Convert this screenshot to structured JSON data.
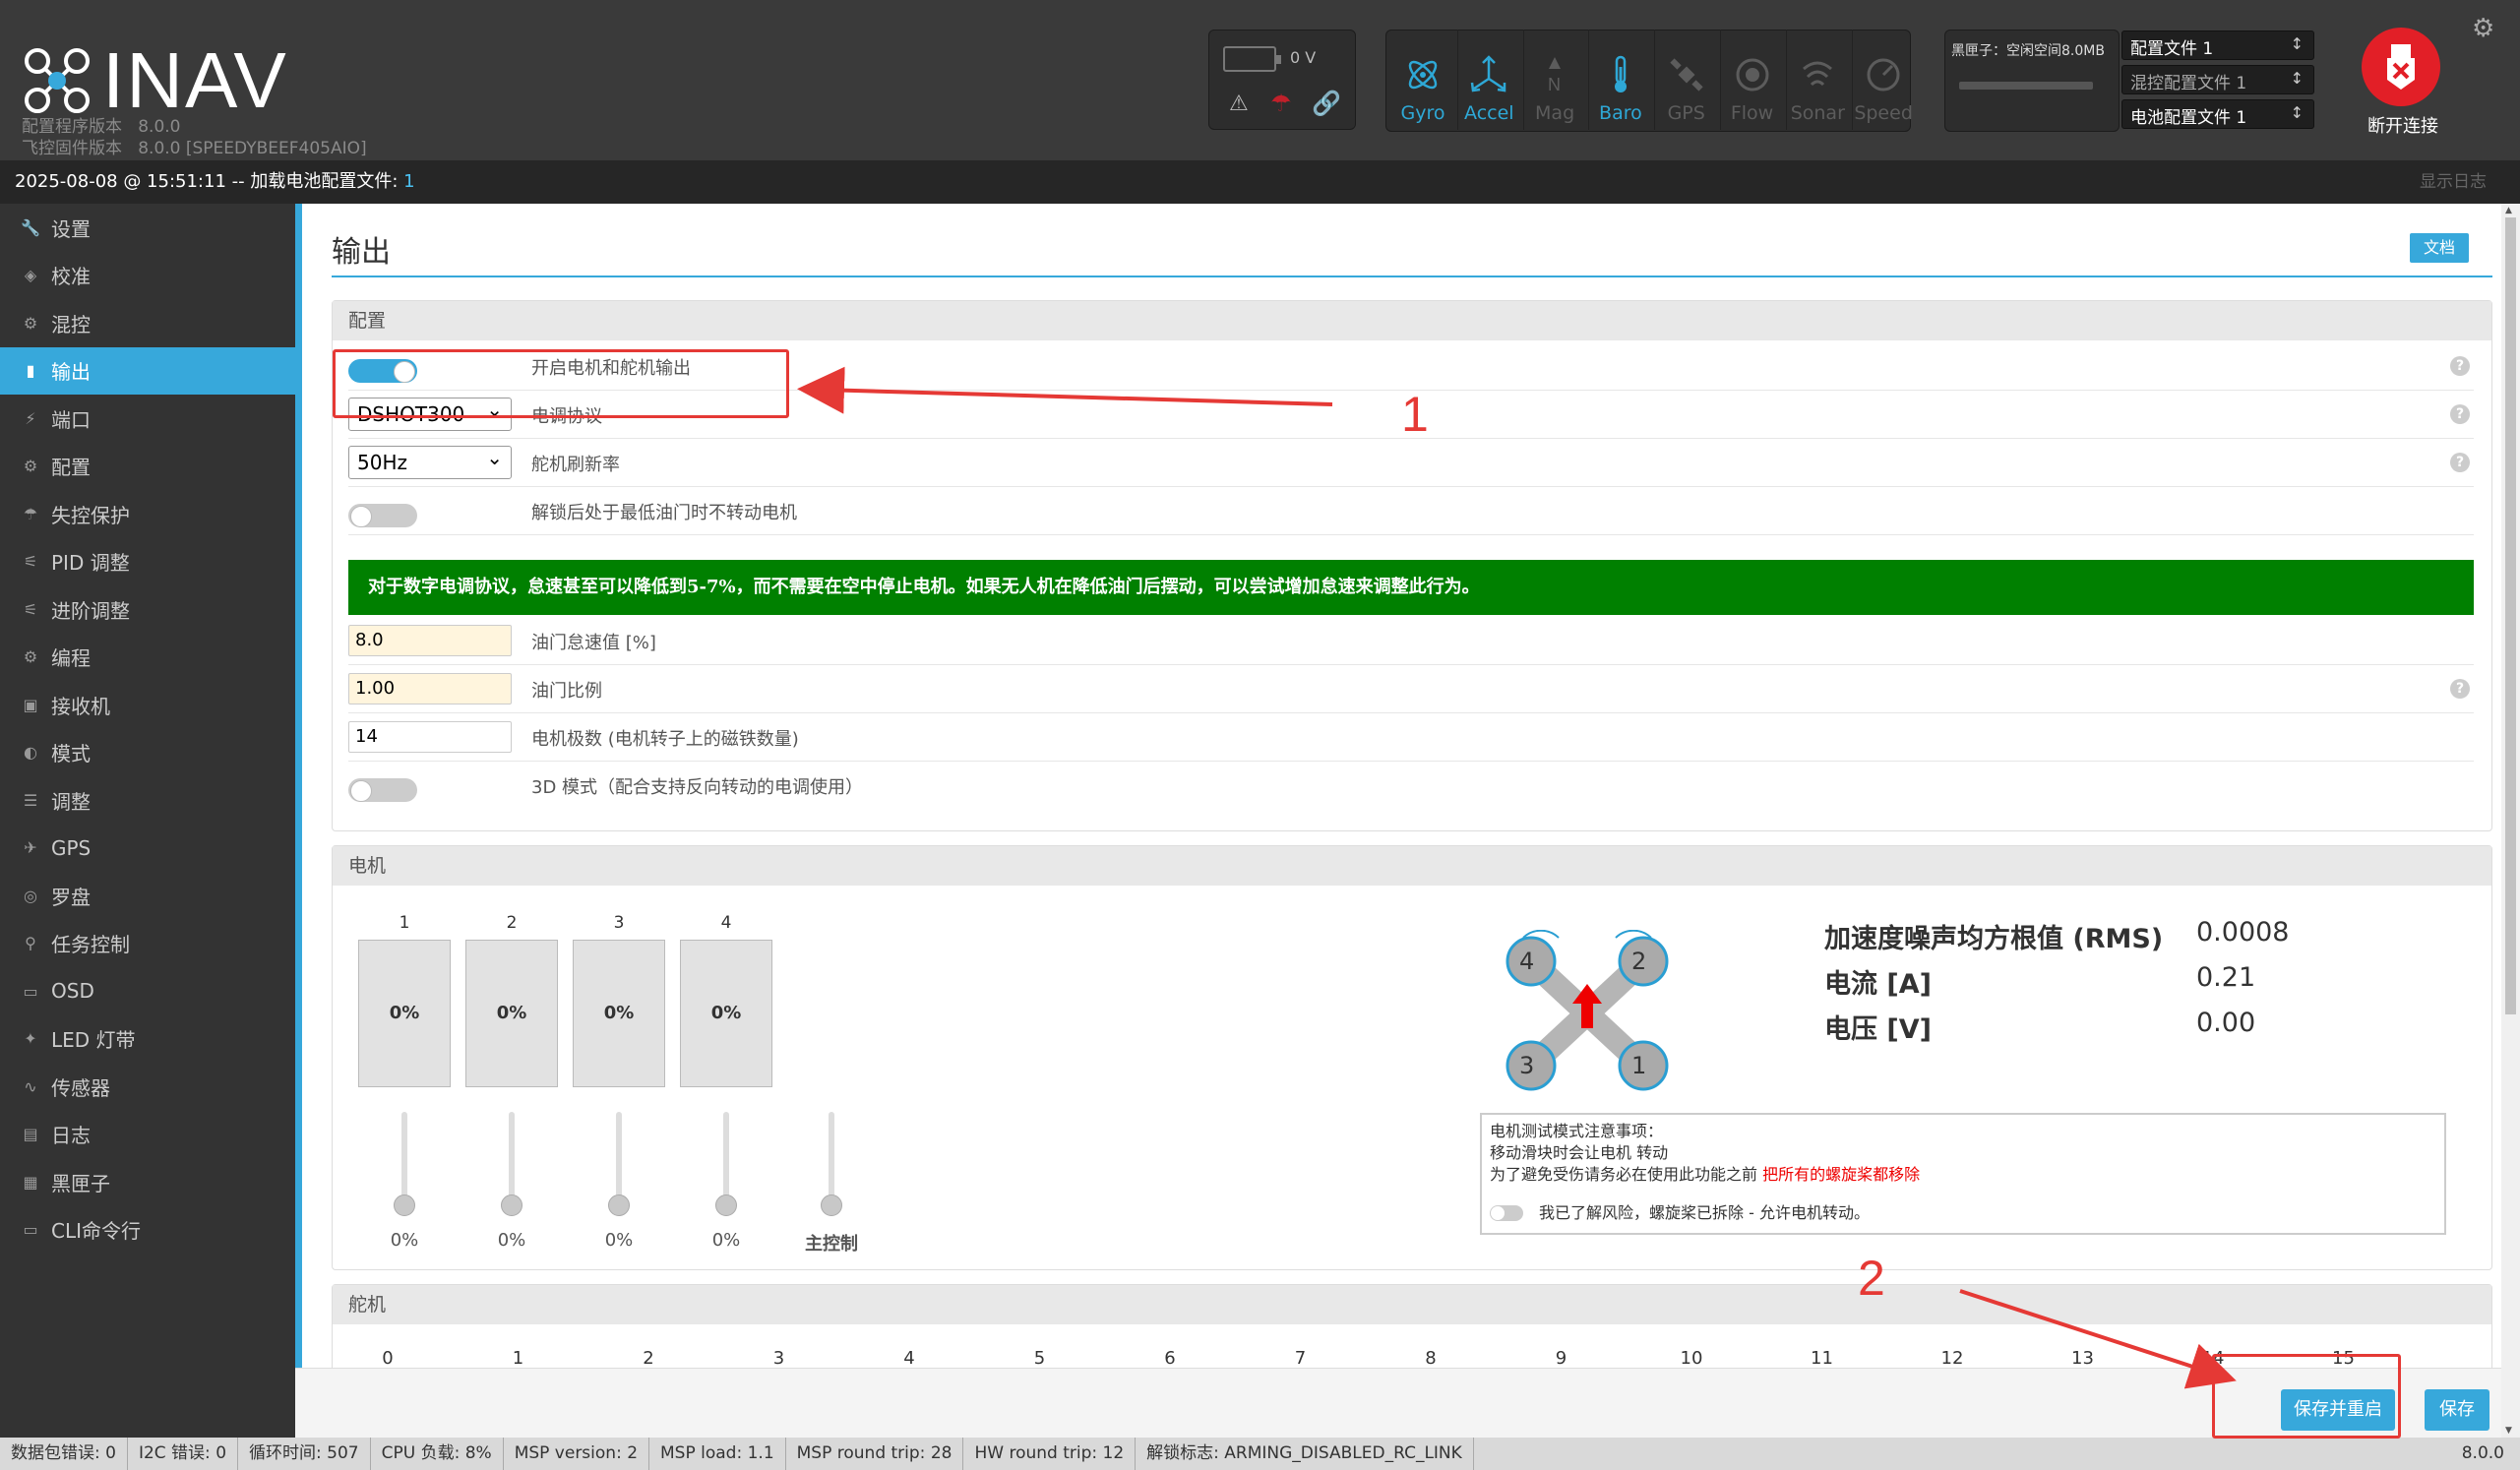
{
  "header": {
    "app_name": "INAV",
    "configurator_version_label": "配置程序版本",
    "configurator_version": "8.0.0",
    "firmware_version_label": "飞控固件版本",
    "firmware_version": "8.0.0 [SPEEDYBEEF405AIO]",
    "battery_voltage": "0 V",
    "sensors": [
      {
        "name": "Gyro",
        "active": true
      },
      {
        "name": "Accel",
        "active": true
      },
      {
        "name": "Mag",
        "active": false
      },
      {
        "name": "Baro",
        "active": true
      },
      {
        "name": "GPS",
        "active": false
      },
      {
        "name": "Flow",
        "active": false
      },
      {
        "name": "Sonar",
        "active": false
      },
      {
        "name": "Speed",
        "active": false
      }
    ],
    "blackbox_label": "黑匣子：空闲空间8.0MB",
    "profile_select": "配置文件 1",
    "mixer_profile_select": "混控配置文件 1",
    "battery_profile_select": "电池配置文件 1",
    "disconnect_label": "断开连接"
  },
  "log_bar": {
    "timestamp": "2025-08-08 @ 15:51:11",
    "message": " -- 加载电池配置文件: ",
    "profile_number": "1",
    "show_log": "显示日志"
  },
  "sidebar": {
    "items": [
      {
        "label": "设置",
        "icon": "wrench-icon",
        "glyph": "🔧",
        "active": false
      },
      {
        "label": "校准",
        "icon": "calibration-icon",
        "glyph": "◈",
        "active": false
      },
      {
        "label": "混控",
        "icon": "mixer-icon",
        "glyph": "⚙",
        "active": false
      },
      {
        "label": "输出",
        "icon": "motor-icon",
        "glyph": "▮",
        "active": true
      },
      {
        "label": "端口",
        "icon": "plug-icon",
        "glyph": "⚡",
        "active": false
      },
      {
        "label": "配置",
        "icon": "gear-icon",
        "glyph": "⚙",
        "active": false
      },
      {
        "label": "失控保护",
        "icon": "parachute-icon",
        "glyph": "☂",
        "active": false
      },
      {
        "label": "PID 调整",
        "icon": "pid-icon",
        "glyph": "⚟",
        "active": false
      },
      {
        "label": "进阶调整",
        "icon": "advanced-tuning-icon",
        "glyph": "⚟",
        "active": false
      },
      {
        "label": "编程",
        "icon": "programming-icon",
        "glyph": "⚙",
        "active": false
      },
      {
        "label": "接收机",
        "icon": "receiver-icon",
        "glyph": "▣",
        "active": false
      },
      {
        "label": "模式",
        "icon": "modes-icon",
        "glyph": "◐",
        "active": false
      },
      {
        "label": "调整",
        "icon": "adjustments-icon",
        "glyph": "☰",
        "active": false
      },
      {
        "label": "GPS",
        "icon": "satellite-icon",
        "glyph": "✈",
        "active": false
      },
      {
        "label": "罗盘",
        "icon": "compass-icon",
        "glyph": "◎",
        "active": false
      },
      {
        "label": "任务控制",
        "icon": "map-marker-icon",
        "glyph": "⚲",
        "active": false
      },
      {
        "label": "OSD",
        "icon": "osd-icon",
        "glyph": "▭",
        "active": false
      },
      {
        "label": "LED 灯带",
        "icon": "led-icon",
        "glyph": "✦",
        "active": false
      },
      {
        "label": "传感器",
        "icon": "sensors-icon",
        "glyph": "∿",
        "active": false
      },
      {
        "label": "日志",
        "icon": "logging-icon",
        "glyph": "▤",
        "active": false
      },
      {
        "label": "黑匣子",
        "icon": "blackbox-icon",
        "glyph": "▦",
        "active": false
      },
      {
        "label": "CLI命令行",
        "icon": "cli-icon",
        "glyph": "▭",
        "active": false
      }
    ]
  },
  "page": {
    "title": "输出",
    "docs_button": "文档"
  },
  "config_panel": {
    "heading": "配置",
    "enable_output_label": "开启电机和舵机输出",
    "esc_protocol": {
      "value": "DSHOT300",
      "label": "电调协议"
    },
    "servo_refresh": {
      "value": "50Hz",
      "label": "舵机刷新率"
    },
    "motor_stop_label": "解锁后处于最低油门时不转动电机",
    "green_notice": "对于数字电调协议，怠速甚至可以降低到5-7%，而不需要在空中停止电机。如果无人机在降低油门后摆动，可以尝试增加怠速来调整此行为。",
    "idle": {
      "value": "8.0",
      "label": "油门怠速值 [%]"
    },
    "throttle_scale": {
      "value": "1.00",
      "label": "油门比例"
    },
    "motor_poles": {
      "value": "14",
      "label": "电机极数 (电机转子上的磁铁数量)"
    },
    "mode_3d_label": "3D 模式（配合支持反向转动的电调使用）"
  },
  "motors_panel": {
    "heading": "电机",
    "motors": [
      {
        "number": "1",
        "output": "0%",
        "slider_value": "0%",
        "slider_level": 0
      },
      {
        "number": "2",
        "output": "0%",
        "slider_value": "0%",
        "slider_level": 0
      },
      {
        "number": "3",
        "output": "0%",
        "slider_value": "0%",
        "slider_level": 0
      },
      {
        "number": "4",
        "output": "0%",
        "slider_value": "0%",
        "slider_level": 0
      }
    ],
    "master_label": "主控制",
    "diagram_labels": [
      "4",
      "2",
      "3",
      "1"
    ],
    "stats": [
      {
        "label": "加速度噪声均方根值 (RMS)",
        "value": "0.0008"
      },
      {
        "label": "电流 [A]",
        "value": "0.21"
      },
      {
        "label": "电压 [V]",
        "value": "0.00"
      }
    ],
    "notice": {
      "title": "电机测试模式注意事项：",
      "line1": "移动滑块时会让电机 转动",
      "line2": "为了避免受伤请务必在使用此功能之前 ",
      "line2_red": "把所有的螺旋桨都移除",
      "ack": "我已了解风险，螺旋桨已拆除 - 允许电机转动。"
    }
  },
  "servos_panel": {
    "heading": "舵机",
    "numbers": [
      "0",
      "1",
      "2",
      "3",
      "4",
      "5",
      "6",
      "7",
      "8",
      "9",
      "10",
      "11",
      "12",
      "13",
      "14",
      "15"
    ]
  },
  "buttons": {
    "save_reboot": "保存并重启",
    "save": "保存"
  },
  "status_bar": {
    "items": [
      "数据包错误: 0",
      "I2C 错误: 0",
      "循环时间: 507",
      "CPU 负载: 8%",
      "MSP version: 2",
      "MSP load: 1.1",
      "MSP round trip: 28",
      "HW round trip: 12",
      "解锁标志: ARMING_DISABLED_RC_LINK"
    ],
    "version": "8.0.0"
  },
  "annotations": {
    "marker1": "1",
    "marker2": "2",
    "color": "#e53935"
  },
  "colors": {
    "accent": "#37a8db",
    "notice_green": "#008000"
  }
}
